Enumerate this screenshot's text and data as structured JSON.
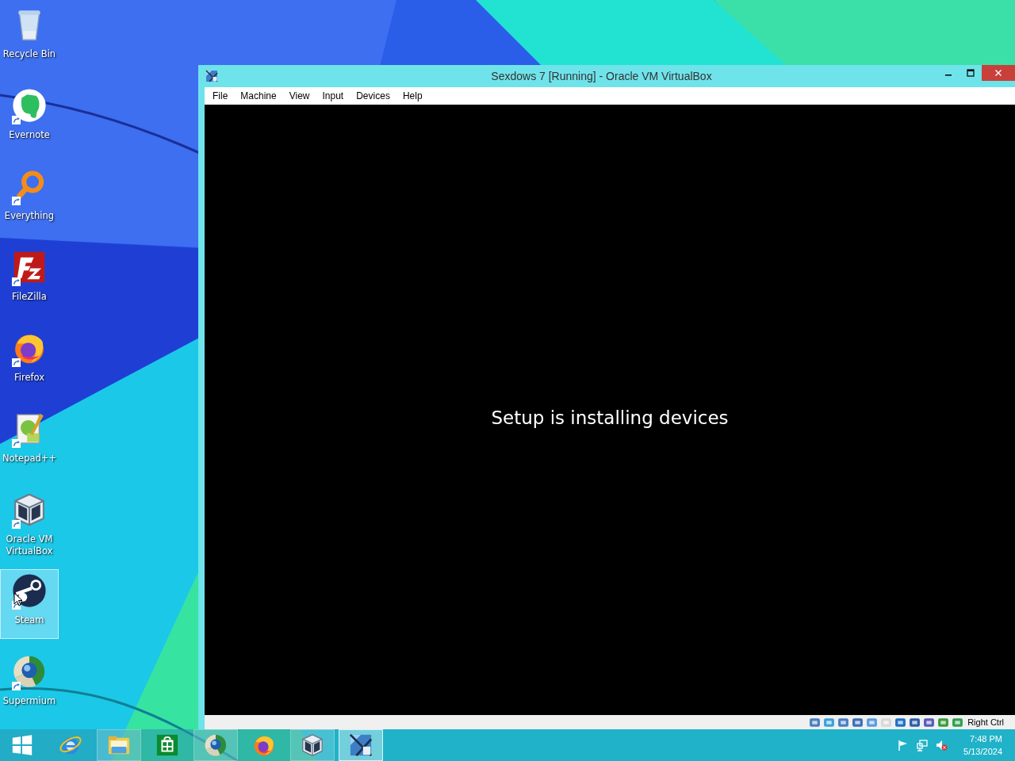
{
  "desktop_icons": [
    {
      "label": "Recycle Bin",
      "kind": "recycle",
      "shortcut": false,
      "selected": false
    },
    {
      "label": "Evernote",
      "kind": "evernote",
      "shortcut": true,
      "selected": false
    },
    {
      "label": "Everything",
      "kind": "everything",
      "shortcut": true,
      "selected": false
    },
    {
      "label": "FileZilla",
      "kind": "filezilla",
      "shortcut": true,
      "selected": false
    },
    {
      "label": "Firefox",
      "kind": "firefox",
      "shortcut": true,
      "selected": false
    },
    {
      "label": "Notepad++",
      "kind": "notepad",
      "shortcut": true,
      "selected": false
    },
    {
      "label": "Oracle VM VirtualBox",
      "kind": "virtualbox",
      "shortcut": true,
      "selected": false
    },
    {
      "label": "Steam",
      "kind": "steam",
      "shortcut": true,
      "selected": true
    },
    {
      "label": "Supermium",
      "kind": "supermium",
      "shortcut": true,
      "selected": false
    }
  ],
  "window": {
    "title": "Sexdows 7 [Running] - Oracle VM VirtualBox",
    "menu": [
      "File",
      "Machine",
      "View",
      "Input",
      "Devices",
      "Help"
    ],
    "screen_text": "Setup is installing devices",
    "host_key": "Right Ctrl"
  },
  "taskbar": {
    "items": [
      {
        "kind": "start",
        "running": false,
        "selected": false
      },
      {
        "kind": "ie",
        "running": false,
        "selected": false
      },
      {
        "kind": "explorer",
        "running": true,
        "selected": false
      },
      {
        "kind": "store",
        "running": false,
        "selected": false
      },
      {
        "kind": "supermium",
        "running": true,
        "selected": false
      },
      {
        "kind": "firefox",
        "running": false,
        "selected": false
      },
      {
        "kind": "virtualbox",
        "running": true,
        "selected": false
      },
      {
        "kind": "sexdows",
        "running": true,
        "selected": true
      }
    ],
    "clock": {
      "time": "7:48 PM",
      "date": "5/13/2024"
    }
  }
}
